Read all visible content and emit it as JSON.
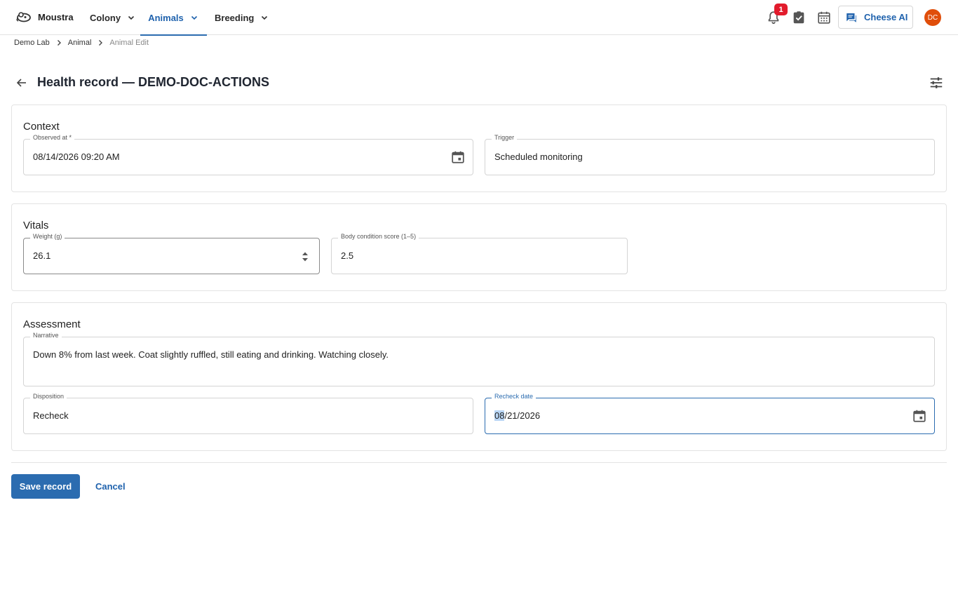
{
  "app": {
    "name": "Moustra"
  },
  "nav": {
    "items": [
      {
        "label": "Colony",
        "active": false
      },
      {
        "label": "Animals",
        "active": true
      },
      {
        "label": "Breeding",
        "active": false
      }
    ]
  },
  "toolbar": {
    "notification_count": "1",
    "ai_button_label": "Cheese AI",
    "avatar_initials": "DC",
    "icons": [
      "bell-icon",
      "task-check-icon",
      "calendar-icon",
      "chat-icon"
    ]
  },
  "breadcrumb": {
    "items": [
      "Demo Lab",
      "Animal"
    ],
    "current": "Animal Edit"
  },
  "page": {
    "title": "Health record — DEMO-DOC-ACTIONS"
  },
  "context": {
    "title": "Context",
    "observed_at": {
      "label": "Observed at *",
      "value": "08/14/2026 09:20 AM"
    },
    "trigger": {
      "label": "Trigger",
      "value": "Scheduled monitoring"
    }
  },
  "vitals": {
    "title": "Vitals",
    "weight": {
      "label": "Weight (g)",
      "value": "26.1"
    },
    "body_condition": {
      "label": "Body condition score (1–5)",
      "value": "2.5"
    }
  },
  "assessment": {
    "title": "Assessment",
    "narrative": {
      "label": "Narrative",
      "value": "Down 8% from last week. Coat slightly ruffled, still eating and drinking. Watching closely."
    },
    "disposition": {
      "label": "Disposition",
      "value": "Recheck"
    },
    "recheck_date": {
      "label": "Recheck date",
      "value_month": "08",
      "value_rest": "/21/2026"
    }
  },
  "actions": {
    "save_label": "Save record",
    "cancel_label": "Cancel"
  },
  "colors": {
    "accent": "#2b6cb0",
    "badge": "#e21b2c",
    "avatar": "#e04e0a"
  }
}
